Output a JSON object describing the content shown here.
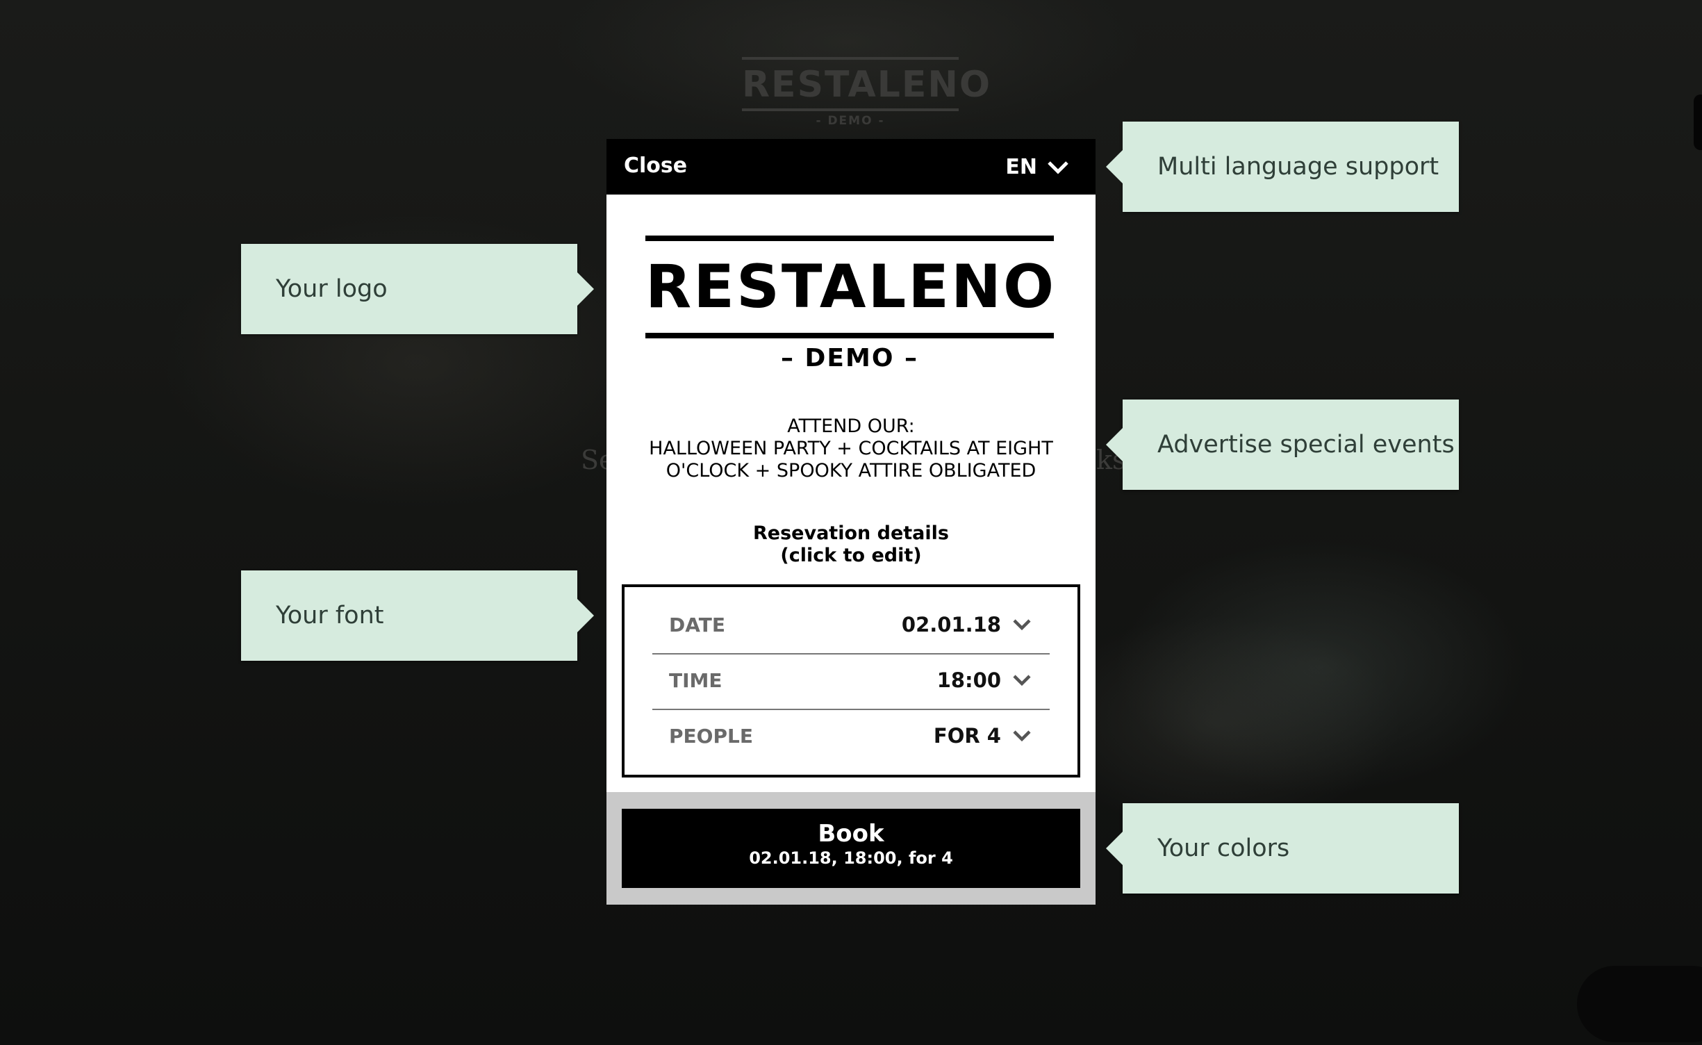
{
  "background": {
    "logo_name": "RESTALENO",
    "logo_sub": "- DEMO -",
    "text_left": "Se",
    "text_right": "ks"
  },
  "modal": {
    "close_label": "Close",
    "language": "EN",
    "logo": {
      "name": "RESTALENO",
      "sub": "– DEMO –"
    },
    "event": {
      "line1": "ATTEND OUR:",
      "line2": "HALLOWEEN PARTY + COCKTAILS AT EIGHT",
      "line3": "O'CLOCK + SPOOKY ATTIRE OBLIGATED"
    },
    "reservation": {
      "caption_line1": "Resevation details",
      "caption_line2": "(click to edit)",
      "rows": [
        {
          "label": "DATE",
          "value": "02.01.18"
        },
        {
          "label": "TIME",
          "value": "18:00"
        },
        {
          "label": "PEOPLE",
          "value": "FOR 4"
        }
      ]
    },
    "book": {
      "title": "Book",
      "summary": "02.01.18, 18:00, for 4"
    }
  },
  "callouts": {
    "logo": "Your logo",
    "font": "Your font",
    "language": "Multi language support",
    "events": "Advertise special events",
    "colors": "Your colors"
  },
  "colors": {
    "callout_bg": "#d6ebde",
    "callout_text": "#2f3f38",
    "modal_header": "#000000",
    "book_button": "#000000",
    "footer_bg": "#c9c9c9"
  }
}
